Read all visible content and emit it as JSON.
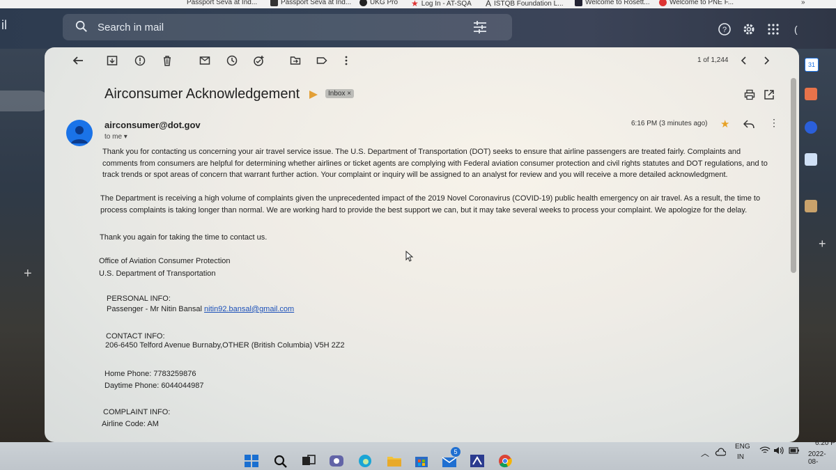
{
  "bookmarks": [
    {
      "label": "Passport Seva at Ind..."
    },
    {
      "label": "Passport Seva at Ind..."
    },
    {
      "label": "UKG Pro"
    },
    {
      "label": "Log In - AT-SQA"
    },
    {
      "label": "ISTQB Foundation L..."
    },
    {
      "label": "Welcome to Rosett..."
    },
    {
      "label": "Welcome to PNE F..."
    },
    {
      "label": "»"
    }
  ],
  "gmail": {
    "logo_fragment": "il",
    "search_placeholder": "Search in mail"
  },
  "toolbar": {
    "pager": "1 of 1,244"
  },
  "email": {
    "subject": "Airconsumer Acknowledgement",
    "label": "Inbox",
    "label_close": "×",
    "sender": "airconsumer@dot.gov",
    "recipient": "to me",
    "time": "6:16 PM (3 minutes ago)",
    "paragraphs": [
      "Thank you for contacting us concerning your air travel service issue. The U.S. Department of Transportation (DOT) seeks to ensure that airline passengers are treated fairly. Complaints and comments from consumers are helpful for determining whether airlines or ticket agents are complying with Federal aviation consumer protection and civil rights statutes and DOT regulations, and to track trends or spot areas of concern that warrant further action. Your complaint or inquiry will be assigned to an analyst for review and you will receive a more detailed acknowledgment.",
      "The Department is receiving a high volume of complaints given the unprecedented impact of the 2019 Novel Coronavirus (COVID-19) public health emergency on air travel. As a result, the time to process complaints is taking longer than normal. We are working hard to provide the best support we can, but it may take several weeks to process your complaint. We apologize for the delay.",
      "Thank you again for taking the time to contact us."
    ],
    "signature_line1": "Office of Aviation Consumer Protection",
    "signature_line2": "U.S. Department of Transportation",
    "personal_heading": "PERSONAL INFO:",
    "passenger": "Passenger - Mr Nitin Bansal",
    "passenger_email": "nitin92.bansal@gmail.com",
    "contact_heading": "CONTACT INFO:",
    "address": "206-6450 Telford Avenue Burnaby,OTHER (British Columbia) V5H 2Z2",
    "home_phone": "Home Phone: 7783259876",
    "daytime_phone": "Daytime Phone: 6044044987",
    "complaint_heading": "COMPLAINT INFO:",
    "airline_code": "Airline Code: AM"
  },
  "sidepanel": {
    "calendar_day": "31"
  },
  "taskbar": {
    "mail_badge": "5",
    "lang": "ENG",
    "region": "IN",
    "time": "6:20 P",
    "date": "2022-08-"
  },
  "colors": {
    "accent": "#1a73e8",
    "star": "#e7a125",
    "importance": "#e3a037"
  }
}
